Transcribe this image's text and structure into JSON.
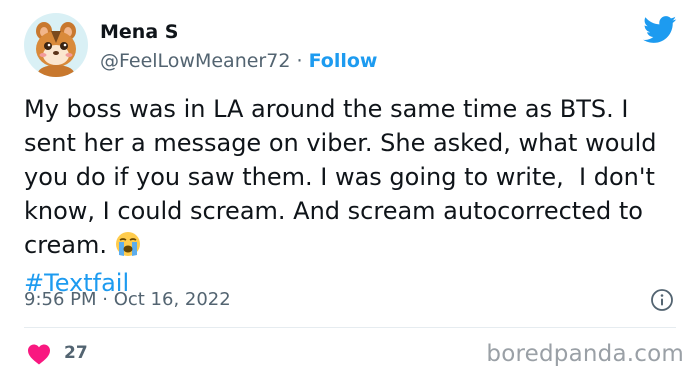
{
  "author": {
    "name": "Mena S",
    "handle": "@FeelLowMeaner72",
    "separator": "·",
    "follow_label": "Follow"
  },
  "tweet": {
    "text": "My boss was in LA around the same time as BTS. I sent her a message on viber. She asked, what would you do if you saw them. I was going to write,  I don't know, I could scream. And scream autocorrected to cream.",
    "emoji": "loudly-crying-face",
    "hashtag": "#Textfail",
    "timestamp": "9:56 PM · Oct 16, 2022"
  },
  "actions": {
    "like_count": "27"
  },
  "icons": {
    "brand": "twitter-bird-icon",
    "info": "info-icon",
    "like": "heart-icon"
  },
  "colors": {
    "link": "#1d9bf0",
    "secondary_text": "#536471",
    "heart": "#f91880",
    "watermark": "#9aa0a6"
  },
  "watermark": "boredpanda.com"
}
